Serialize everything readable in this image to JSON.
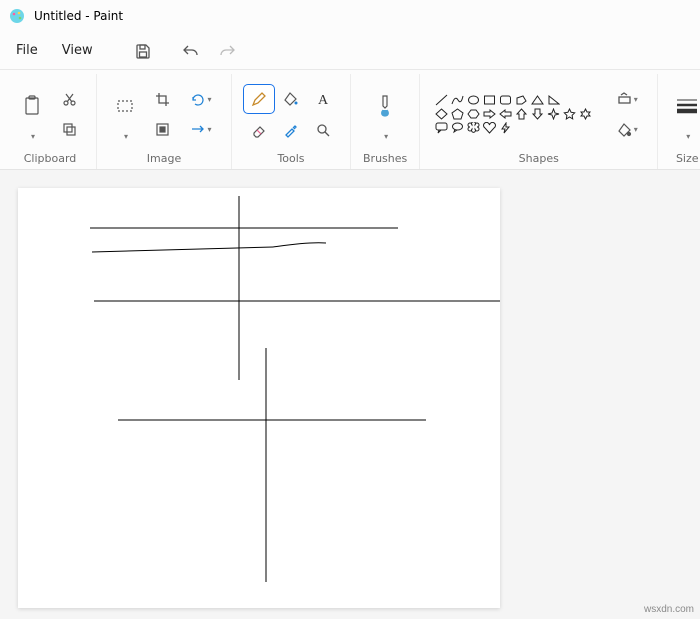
{
  "title": "Untitled - Paint",
  "menu": {
    "file": "File",
    "view": "View"
  },
  "groups": {
    "clipboard": "Clipboard",
    "image": "Image",
    "tools": "Tools",
    "brushes": "Brushes",
    "shapes": "Shapes",
    "size": "Size"
  },
  "watermark": "wsxdn.com"
}
